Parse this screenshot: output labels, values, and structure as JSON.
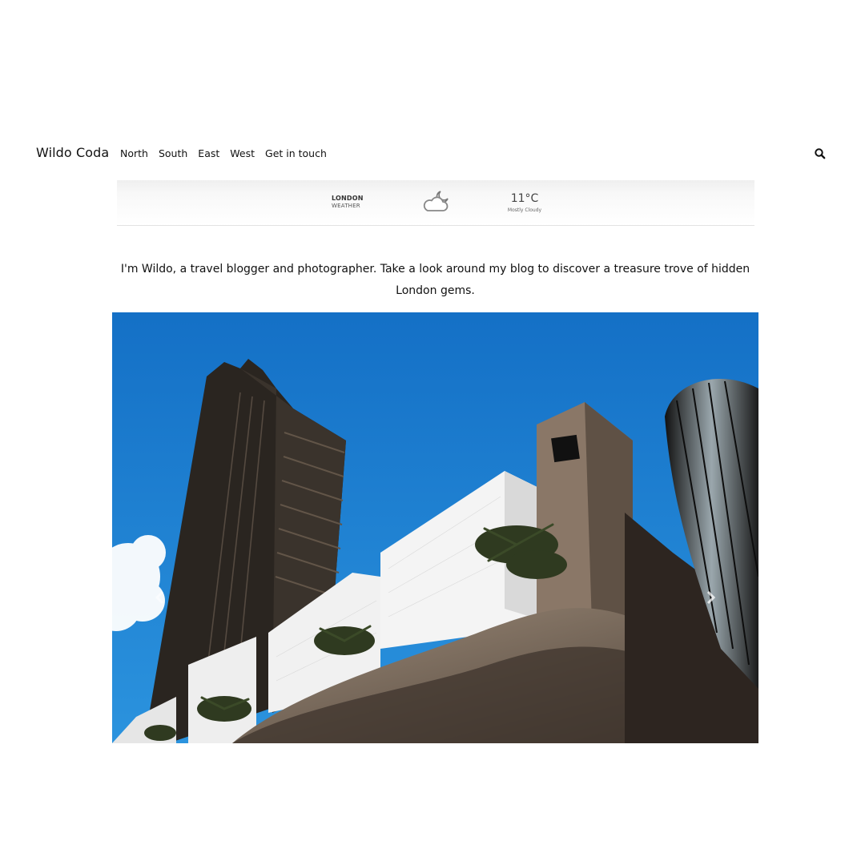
{
  "site": {
    "brand": "Wildo Coda"
  },
  "nav": {
    "items": [
      {
        "label": "North"
      },
      {
        "label": "South"
      },
      {
        "label": "East"
      },
      {
        "label": "West"
      },
      {
        "label": "Get in touch"
      }
    ],
    "search_icon": "search-icon"
  },
  "weather": {
    "city": "LONDON",
    "label": "WEATHER",
    "icon": "cloud-moon-icon",
    "temperature": "11°C",
    "condition": "Mostly Cloudy"
  },
  "intro": {
    "text": "I'm Wildo, a travel blogger and photographer. Take a look around my blog to discover a treasure trove of hidden London gems."
  },
  "carousel": {
    "prev_icon": "chevron-left-icon",
    "next_icon": "chevron-right-icon"
  },
  "colors": {
    "sky": "#1a7fd0",
    "text": "#111111"
  }
}
